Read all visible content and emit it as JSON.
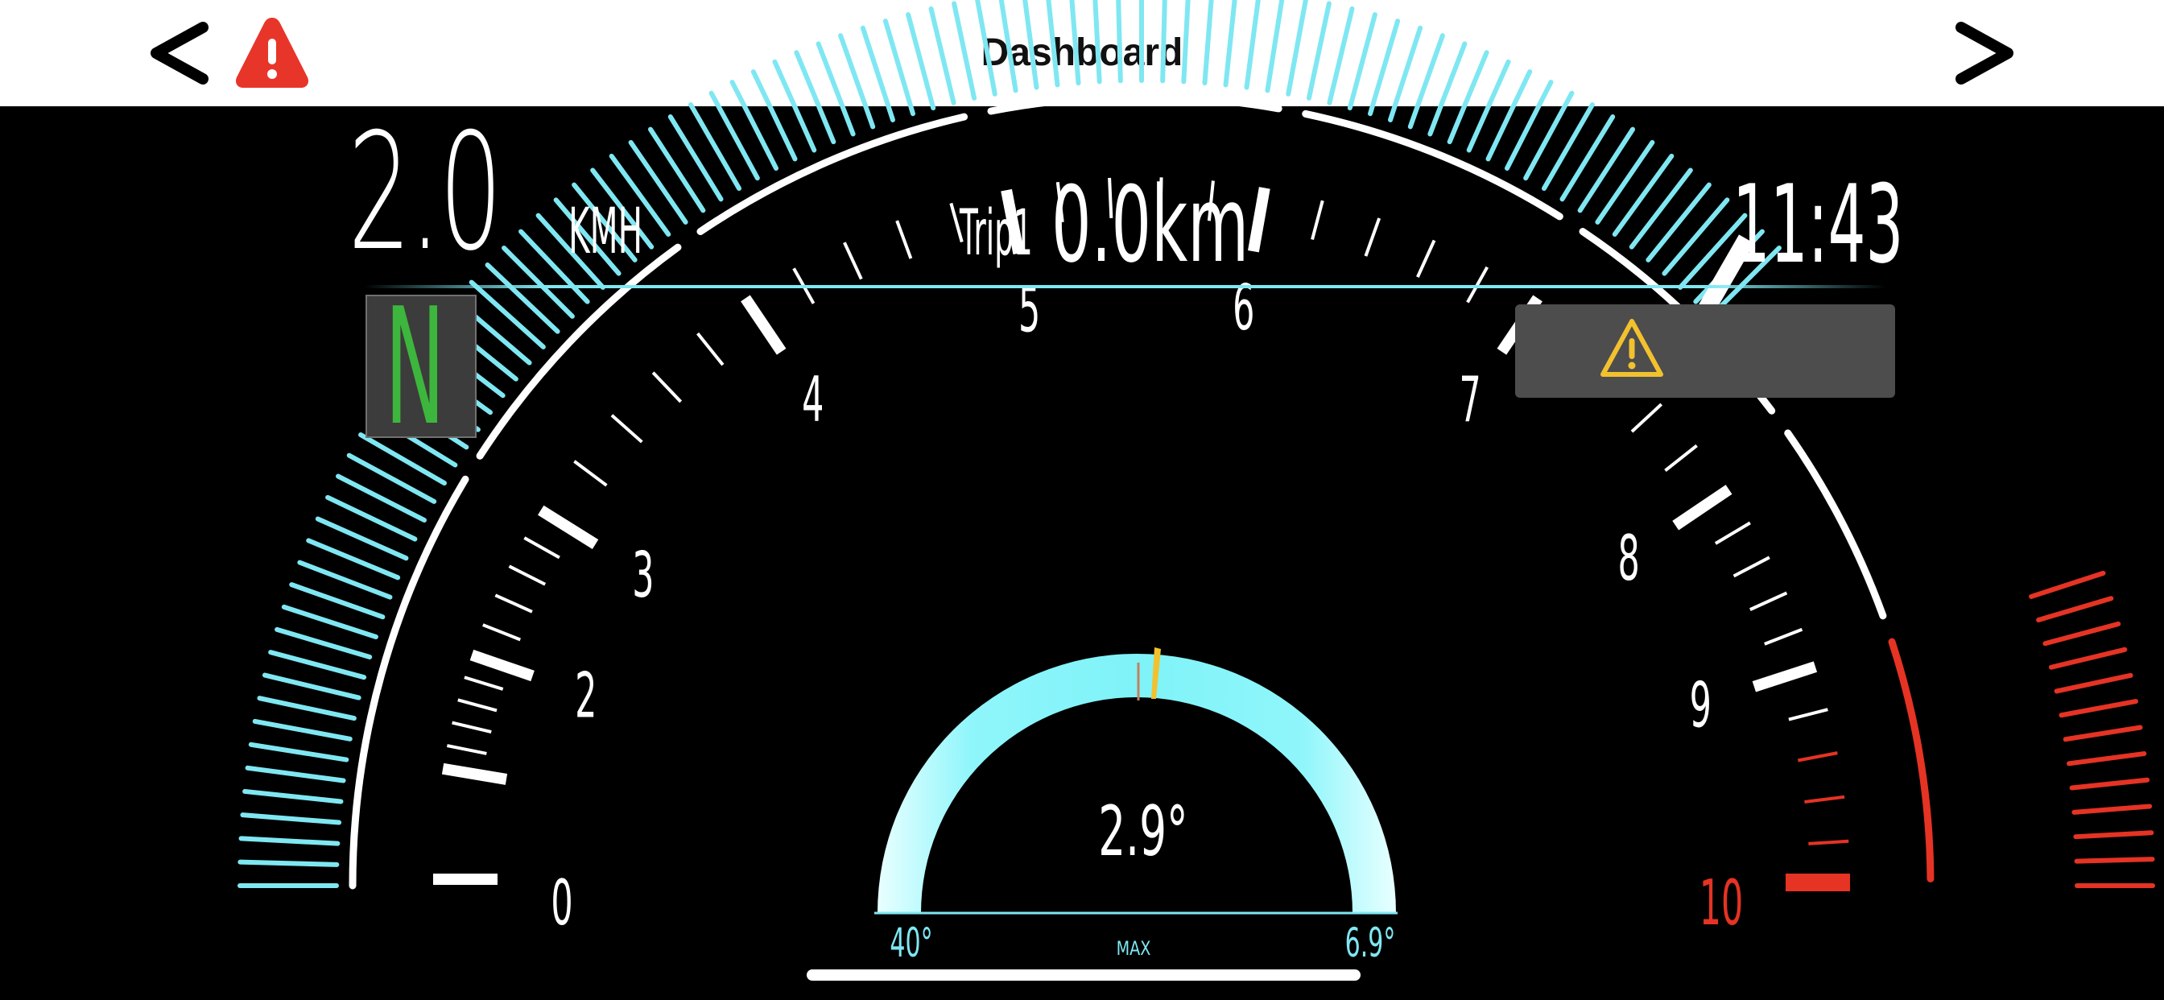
{
  "header": {
    "title": "Dashboard"
  },
  "speed": {
    "value": "2.0",
    "unit": "KMH"
  },
  "trip": {
    "label": "Trip1",
    "value": "0.0km"
  },
  "clock": "11:43",
  "gear": "N",
  "tachometer": {
    "labels": [
      "0",
      "2",
      "3",
      "4",
      "5",
      "6",
      "7",
      "8",
      "9",
      "10"
    ],
    "label_values": [
      0,
      2,
      3,
      4,
      5,
      6,
      7,
      8,
      9,
      10
    ],
    "needle_value": 7.55,
    "redline_start": 9.3,
    "max": 10
  },
  "lean": {
    "value_label": "2.9°",
    "left_max_label": "40°",
    "right_max_label": "6.9°",
    "max_label": "MAX"
  },
  "colors": {
    "accent": "#7fe7f2",
    "redline": "#e53324",
    "gear": "#3cb63c",
    "warning": "#f2c12e",
    "alert": "#e8352a"
  }
}
